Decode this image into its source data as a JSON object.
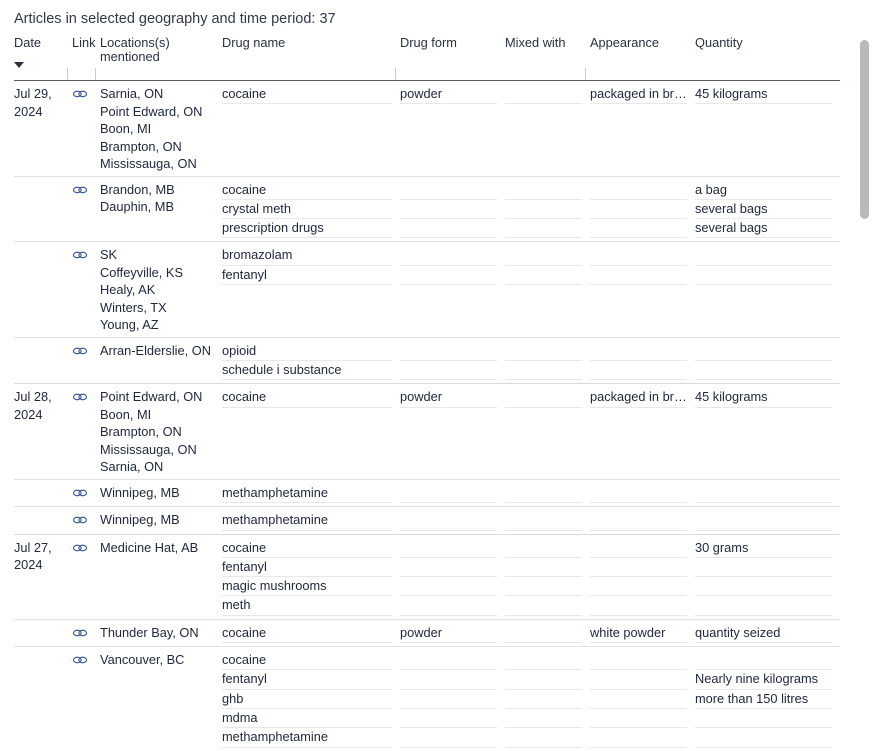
{
  "caption": "Articles in selected geography and time period: 37",
  "table": {
    "columns": [
      {
        "key": "date",
        "label": "Date"
      },
      {
        "key": "link",
        "label": "Link"
      },
      {
        "key": "locations",
        "label": "Locations(s) mentioned"
      },
      {
        "key": "drug_name",
        "label": "Drug name"
      },
      {
        "key": "drug_form",
        "label": "Drug form"
      },
      {
        "key": "mixed_with",
        "label": "Mixed with"
      },
      {
        "key": "appearance",
        "label": "Appearance"
      },
      {
        "key": "quantity",
        "label": "Quantity"
      }
    ],
    "sort": {
      "column": "Date",
      "direction": "descending",
      "icon": "caret-down-icon"
    },
    "link_icon": "chain-link-icon",
    "groups": [
      {
        "date": "Jul 29, 2024",
        "records": [
          {
            "locations": [
              "Sarnia, ON",
              "Point Edward, ON",
              "Boon, MI",
              "Brampton, ON",
              "Mississauga, ON"
            ],
            "rows": [
              {
                "drug_name": "cocaine",
                "drug_form": "powder",
                "mixed_with": "",
                "appearance": "packaged in bricks",
                "quantity": "45 kilograms"
              }
            ]
          },
          {
            "locations": [
              "Brandon, MB",
              "Dauphin, MB"
            ],
            "rows": [
              {
                "drug_name": "cocaine",
                "drug_form": "",
                "mixed_with": "",
                "appearance": "",
                "quantity": "a bag"
              },
              {
                "drug_name": "crystal meth",
                "drug_form": "",
                "mixed_with": "",
                "appearance": "",
                "quantity": "several bags"
              },
              {
                "drug_name": "prescription drugs",
                "drug_form": "",
                "mixed_with": "",
                "appearance": "",
                "quantity": "several bags"
              }
            ]
          },
          {
            "locations": [
              "SK",
              "Coffeyville, KS",
              "Healy, AK",
              "Winters, TX",
              "Young, AZ"
            ],
            "rows": [
              {
                "drug_name": "bromazolam",
                "drug_form": "",
                "mixed_with": "",
                "appearance": "",
                "quantity": ""
              },
              {
                "drug_name": "fentanyl",
                "drug_form": "",
                "mixed_with": "",
                "appearance": "",
                "quantity": ""
              }
            ]
          },
          {
            "locations": [
              "Arran-Elderslie, ON"
            ],
            "rows": [
              {
                "drug_name": "opioid",
                "drug_form": "",
                "mixed_with": "",
                "appearance": "",
                "quantity": ""
              },
              {
                "drug_name": "schedule i substance",
                "drug_form": "",
                "mixed_with": "",
                "appearance": "",
                "quantity": ""
              }
            ]
          }
        ]
      },
      {
        "date": "Jul 28, 2024",
        "records": [
          {
            "locations": [
              "Point Edward, ON",
              "Boon, MI",
              "Brampton, ON",
              "Mississauga, ON",
              "Sarnia, ON"
            ],
            "rows": [
              {
                "drug_name": "cocaine",
                "drug_form": "powder",
                "mixed_with": "",
                "appearance": "packaged in bricks",
                "quantity": "45 kilograms"
              }
            ]
          },
          {
            "locations": [
              "Winnipeg, MB"
            ],
            "rows": [
              {
                "drug_name": "methamphetamine",
                "drug_form": "",
                "mixed_with": "",
                "appearance": "",
                "quantity": ""
              }
            ]
          },
          {
            "locations": [
              "Winnipeg, MB"
            ],
            "rows": [
              {
                "drug_name": "methamphetamine",
                "drug_form": "",
                "mixed_with": "",
                "appearance": "",
                "quantity": ""
              }
            ]
          }
        ]
      },
      {
        "date": "Jul 27, 2024",
        "records": [
          {
            "locations": [
              "Medicine Hat, AB"
            ],
            "rows": [
              {
                "drug_name": "cocaine",
                "drug_form": "",
                "mixed_with": "",
                "appearance": "",
                "quantity": "30 grams"
              },
              {
                "drug_name": "fentanyl",
                "drug_form": "",
                "mixed_with": "",
                "appearance": "",
                "quantity": ""
              },
              {
                "drug_name": "magic mushrooms",
                "drug_form": "",
                "mixed_with": "",
                "appearance": "",
                "quantity": ""
              },
              {
                "drug_name": "meth",
                "drug_form": "",
                "mixed_with": "",
                "appearance": "",
                "quantity": ""
              }
            ]
          },
          {
            "locations": [
              "Thunder Bay, ON"
            ],
            "rows": [
              {
                "drug_name": "cocaine",
                "drug_form": "powder",
                "mixed_with": "",
                "appearance": "white powder",
                "quantity": "quantity seized"
              }
            ]
          },
          {
            "locations": [
              "Vancouver, BC"
            ],
            "rows": [
              {
                "drug_name": "cocaine",
                "drug_form": "",
                "mixed_with": "",
                "appearance": "",
                "quantity": ""
              },
              {
                "drug_name": "fentanyl",
                "drug_form": "",
                "mixed_with": "",
                "appearance": "",
                "quantity": "Nearly nine kilograms"
              },
              {
                "drug_name": "ghb",
                "drug_form": "",
                "mixed_with": "",
                "appearance": "",
                "quantity": "more than 150 litres"
              },
              {
                "drug_name": "mdma",
                "drug_form": "",
                "mixed_with": "",
                "appearance": "",
                "quantity": ""
              },
              {
                "drug_name": "methamphetamine",
                "drug_form": "",
                "mixed_with": "",
                "appearance": "",
                "quantity": ""
              }
            ]
          }
        ]
      }
    ]
  },
  "scrollbar": {
    "name": "vertical-scrollbar",
    "thumb_top_pct": 3,
    "thumb_height_pct": 56
  },
  "colors": {
    "text": "#202a3d",
    "header_rule": "#555d69",
    "row_rule": "#e6e8ea",
    "group_rule": "#d8dadd",
    "link_icon": "#3b5998",
    "scrollbar_thumb": "#b9b9b9"
  }
}
